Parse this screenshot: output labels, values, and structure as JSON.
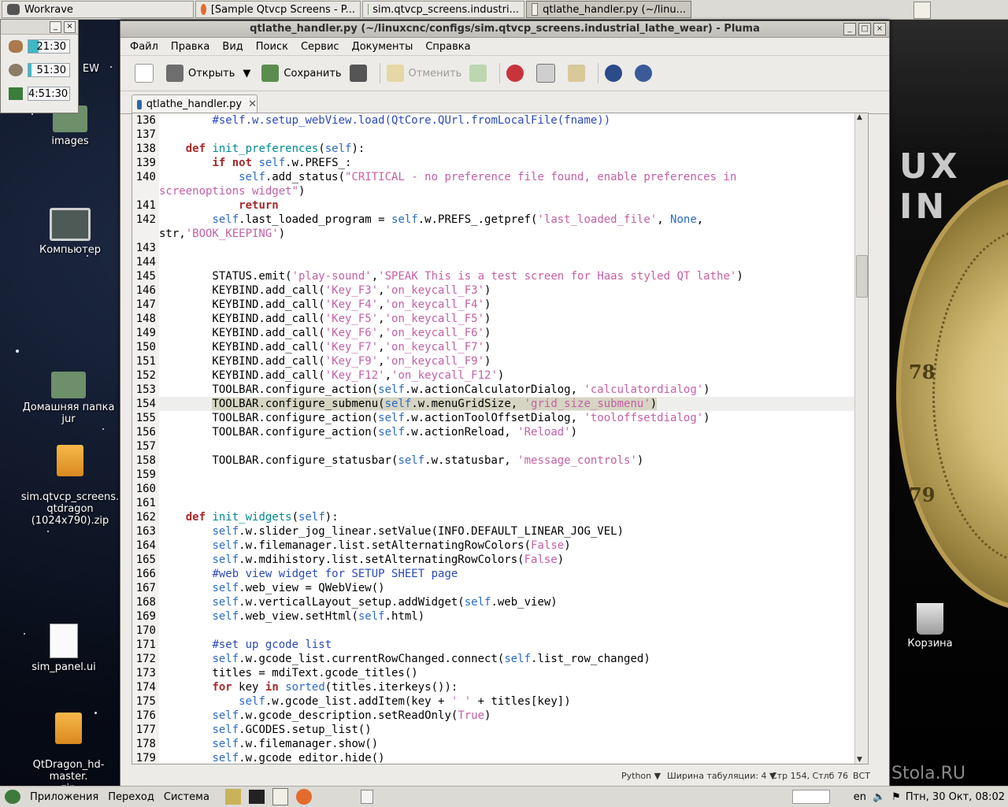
{
  "taskbar": {
    "tasks": [
      {
        "label": "Workrave"
      },
      {
        "label": "[Sample Qtvcp Screens - P..."
      },
      {
        "label": "sim.qtvcp_screens.industri..."
      },
      {
        "label": "qtlathe_handler.py (~/linu..."
      }
    ]
  },
  "workrave": {
    "timers": [
      {
        "value": "21:30",
        "fraction": 0.25
      },
      {
        "value": "51:30",
        "fraction": 0.08
      },
      {
        "value": "4:51:30",
        "fraction": 0.0
      }
    ]
  },
  "desktop": {
    "icons": [
      {
        "label": "EW"
      },
      {
        "label": "images"
      },
      {
        "label": "Компьютер"
      },
      {
        "label": "Домашняя папка jur"
      },
      {
        "label": "sim.qtvcp_screens.\nqtdragon\n(1024x790).zip"
      },
      {
        "label": "sim_panel.ui"
      },
      {
        "label": "QtDragon_hd-master.\nzip"
      },
      {
        "label": "Корзина"
      }
    ],
    "coin_numbers": [
      "78",
      "79"
    ],
    "brand_text": "UX IN",
    "watermark": "Stola.RU"
  },
  "window": {
    "title": "qtlathe_handler.py (~/linuxcnc/configs/sim.qtvcp_screens.industrial_lathe_wear) - Pluma",
    "menu": [
      "Файл",
      "Правка",
      "Вид",
      "Поиск",
      "Сервис",
      "Документы",
      "Справка"
    ],
    "toolbar": {
      "open_label": "Открыть",
      "save_label": "Сохранить",
      "undo_label": "Отменить"
    },
    "tab_label": "qtlathe_handler.py",
    "status": {
      "language": "Python",
      "tab_width": "Ширина табуляции:  4",
      "position": "Стр 154, Стлб 76",
      "mode": "ВСТ"
    }
  },
  "bottom_panel": {
    "menus": [
      "Приложения",
      "Переход",
      "Система"
    ],
    "lang": "en",
    "clock": "Птн, 30 Окт, 08:02"
  },
  "code": {
    "current_line": 154,
    "lines": [
      {
        "n": "136",
        "html": "        <span class=\"c\">#self.w.setup_webView.load(QtCore.QUrl.fromLocalFile(fname))</span>"
      },
      {
        "n": "137",
        "html": ""
      },
      {
        "n": "138",
        "html": "    <span class=\"k\">def</span> <span class=\"f\">init_preferences</span>(<span class=\"b\">self</span>):"
      },
      {
        "n": "139",
        "html": "        <span class=\"k\">if not</span> <span class=\"b\">self</span>.w.PREFS_:"
      },
      {
        "n": "140",
        "html": "            <span class=\"b\">self</span>.add_status(<span class=\"s\">\"CRITICAL - no preference file found, enable preferences in</span>"
      },
      {
        "n": "",
        "html": "<span class=\"s\">screenoptions widget\"</span>)"
      },
      {
        "n": "141",
        "html": "            <span class=\"k\">return</span>"
      },
      {
        "n": "142",
        "html": "        <span class=\"b\">self</span>.last_loaded_program = <span class=\"b\">self</span>.w.PREFS_.getpref(<span class=\"s\">'last_loaded_file'</span>, <span class=\"b\">None</span>,"
      },
      {
        "n": "",
        "html": "str,<span class=\"s\">'BOOK_KEEPING'</span>)"
      },
      {
        "n": "143",
        "html": ""
      },
      {
        "n": "144",
        "html": ""
      },
      {
        "n": "145",
        "html": "        STATUS.emit(<span class=\"s\">'play-sound'</span>,<span class=\"s\">'SPEAK This is a test screen for Haas styled QT lathe'</span>)"
      },
      {
        "n": "146",
        "html": "        KEYBIND.add_call(<span class=\"s\">'Key_F3'</span>,<span class=\"s\">'on_keycall_F3'</span>)"
      },
      {
        "n": "147",
        "html": "        KEYBIND.add_call(<span class=\"s\">'Key_F4'</span>,<span class=\"s\">'on_keycall_F4'</span>)"
      },
      {
        "n": "148",
        "html": "        KEYBIND.add_call(<span class=\"s\">'Key_F5'</span>,<span class=\"s\">'on_keycall_F5'</span>)"
      },
      {
        "n": "149",
        "html": "        KEYBIND.add_call(<span class=\"s\">'Key_F6'</span>,<span class=\"s\">'on_keycall_F6'</span>)"
      },
      {
        "n": "150",
        "html": "        KEYBIND.add_call(<span class=\"s\">'Key_F7'</span>,<span class=\"s\">'on_keycall_F7'</span>)"
      },
      {
        "n": "151",
        "html": "        KEYBIND.add_call(<span class=\"s\">'Key_F9'</span>,<span class=\"s\">'on_keycall_F9'</span>)"
      },
      {
        "n": "152",
        "html": "        KEYBIND.add_call(<span class=\"s\">'Key_F12'</span>,<span class=\"s\">'on_keycall_F12'</span>)"
      },
      {
        "n": "153",
        "html": "        TOOLBAR.configure_action(<span class=\"b\">self</span>.w.actionCalculatorDialog, <span class=\"s\">'calculatordialog'</span>)"
      },
      {
        "n": "154",
        "html": "        <span class=\"sel\">TOOLBAR.configure_submenu(<span class=\"b\">self</span>.w.menuGridSize, <span class=\"s\">'grid_size_submenu'</span>)</span>"
      },
      {
        "n": "155",
        "html": "        TOOLBAR.configure_action(<span class=\"b\">self</span>.w.actionToolOffsetDialog, <span class=\"s\">'tooloffsetdialog'</span>)"
      },
      {
        "n": "156",
        "html": "        TOOLBAR.configure_action(<span class=\"b\">self</span>.w.actionReload, <span class=\"s\">'Reload'</span>)"
      },
      {
        "n": "157",
        "html": ""
      },
      {
        "n": "158",
        "html": "        TOOLBAR.configure_statusbar(<span class=\"b\">self</span>.w.statusbar, <span class=\"s\">'message_controls'</span>)"
      },
      {
        "n": "159",
        "html": ""
      },
      {
        "n": "160",
        "html": ""
      },
      {
        "n": "161",
        "html": ""
      },
      {
        "n": "162",
        "html": "    <span class=\"k\">def</span> <span class=\"f\">init_widgets</span>(<span class=\"b\">self</span>):"
      },
      {
        "n": "163",
        "html": "        <span class=\"b\">self</span>.w.slider_jog_linear.setValue(INFO.DEFAULT_LINEAR_JOG_VEL)"
      },
      {
        "n": "164",
        "html": "        <span class=\"b\">self</span>.w.filemanager.list.setAlternatingRowColors(<span class=\"s\">False</span>)"
      },
      {
        "n": "165",
        "html": "        <span class=\"b\">self</span>.w.mdihistory.list.setAlternatingRowColors(<span class=\"s\">False</span>)"
      },
      {
        "n": "166",
        "html": "        <span class=\"c\">#web view widget for SETUP SHEET page</span>"
      },
      {
        "n": "167",
        "html": "        <span class=\"b\">self</span>.web_view = QWebView()"
      },
      {
        "n": "168",
        "html": "        <span class=\"b\">self</span>.w.verticalLayout_setup.addWidget(<span class=\"b\">self</span>.web_view)"
      },
      {
        "n": "169",
        "html": "        <span class=\"b\">self</span>.web_view.setHtml(<span class=\"b\">self</span>.html)"
      },
      {
        "n": "170",
        "html": ""
      },
      {
        "n": "171",
        "html": "        <span class=\"c\">#set up gcode list</span>"
      },
      {
        "n": "172",
        "html": "        <span class=\"b\">self</span>.w.gcode_list.currentRowChanged.connect(<span class=\"b\">self</span>.list_row_changed)"
      },
      {
        "n": "173",
        "html": "        titles = mdiText.gcode_titles()"
      },
      {
        "n": "174",
        "html": "        <span class=\"k\">for</span> key <span class=\"k\">in</span> <span class=\"b\">sorted</span>(titles.iterkeys()):"
      },
      {
        "n": "175",
        "html": "            <span class=\"b\">self</span>.w.gcode_list.addItem(key + <span class=\"s\">' '</span> + titles[key])"
      },
      {
        "n": "176",
        "html": "        <span class=\"b\">self</span>.w.gcode_description.setReadOnly(<span class=\"s\">True</span>)"
      },
      {
        "n": "177",
        "html": "        <span class=\"b\">self</span>.GCODES.setup_list()"
      },
      {
        "n": "178",
        "html": "        <span class=\"b\">self</span>.w.filemanager.show()"
      },
      {
        "n": "179",
        "html": "        <span class=\"b\">self</span>.w.gcode_editor.hide()"
      }
    ]
  }
}
